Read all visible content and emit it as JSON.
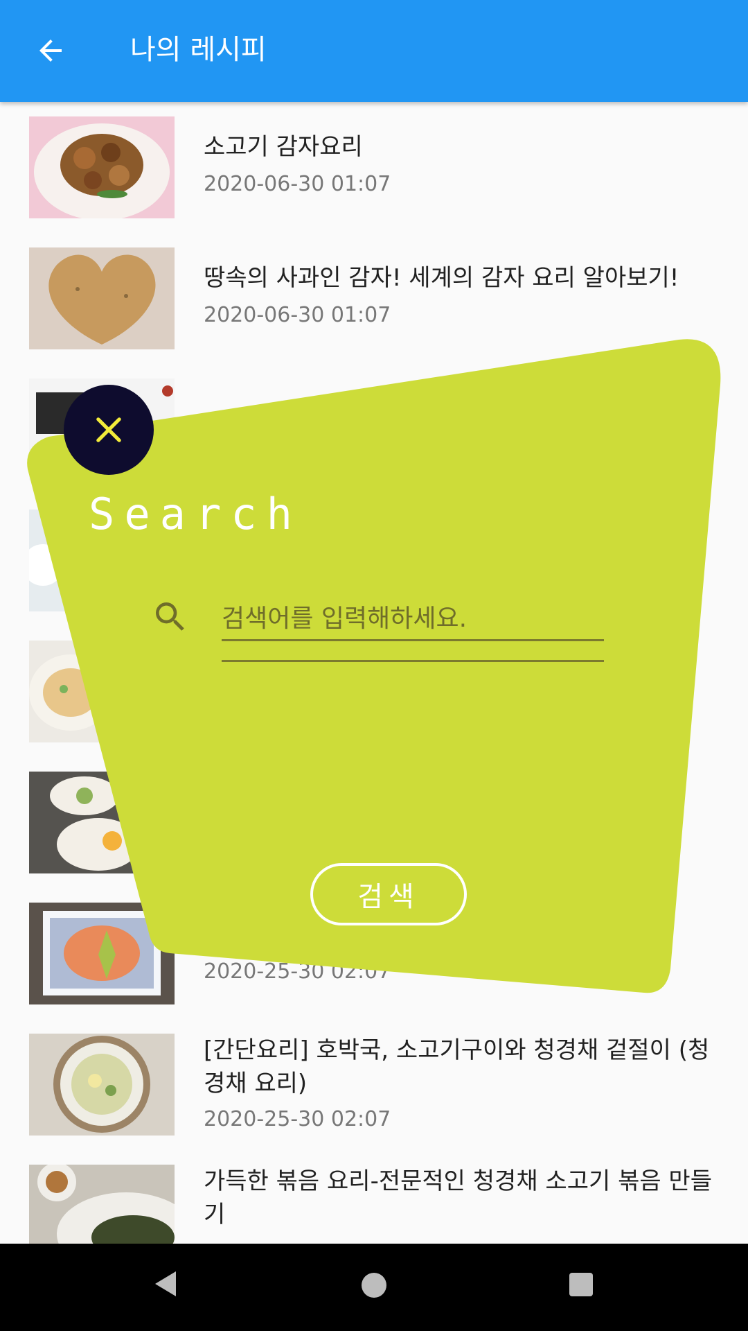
{
  "app": {
    "title": "나의 레시피"
  },
  "recipes": [
    {
      "title": "소고기 감자요리",
      "date": "2020-06-30 01:07"
    },
    {
      "title": "땅속의 사과인 감자! 세계의 감자 요리 알아보기!",
      "date": "2020-06-30 01:07"
    },
    {
      "title": "",
      "date": ""
    },
    {
      "title": "",
      "date": ""
    },
    {
      "title": "",
      "date": ""
    },
    {
      "title": "",
      "date": ""
    },
    {
      "title": "",
      "date": "2020-25-30 02:07"
    },
    {
      "title": "[간단요리] 호박국, 소고기구이와 청경채 겉절이 (청경채 요리)",
      "date": "2020-25-30 02:07"
    },
    {
      "title": "가득한 볶음 요리-전문적인 청경채 소고기 볶음 만들기",
      "date": ""
    }
  ],
  "search_dialog": {
    "heading": "Search",
    "placeholder": "검색어를 입력해하세요.",
    "submit_label": "검색",
    "background_color": "#CDDC39",
    "close_button_color": "#0E0C2E"
  },
  "colors": {
    "appbar": "#2196F3"
  },
  "icons": {
    "back": "arrow-left-icon",
    "close": "close-icon",
    "search": "search-icon"
  }
}
